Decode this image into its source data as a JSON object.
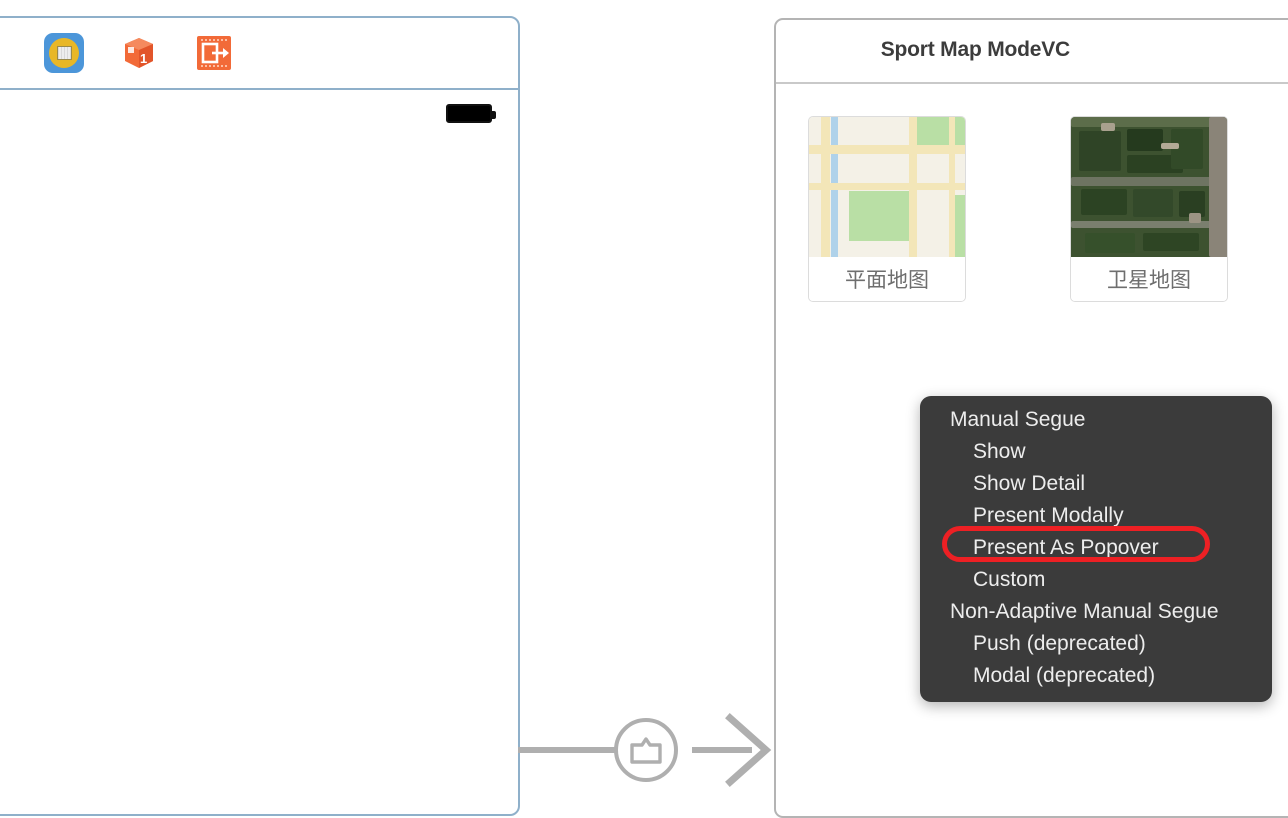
{
  "canvas": {
    "background_color": "#ffffff"
  },
  "left_scene": {
    "border_color": "#8FB0CA",
    "dock": {
      "icons": [
        {
          "name": "view-controller-icon",
          "label": "View Controller",
          "selected": true
        },
        {
          "name": "first-responder-icon",
          "label": "First Responder",
          "badge": "1"
        },
        {
          "name": "exit-icon",
          "label": "Exit"
        }
      ]
    },
    "status_bar": {
      "battery": {
        "name": "battery-icon",
        "level_label": "Battery"
      }
    }
  },
  "segue": {
    "name": "present-modally-segue",
    "badge": "present-modally-glyph",
    "stroke_color": "#AFAFAF"
  },
  "right_scene": {
    "border_color": "#B4B4B4",
    "nav_bar": {
      "title": "Sport Map ModeVC"
    },
    "map_cards": [
      {
        "id": "standard-map",
        "caption": "平面地图",
        "thumb": "standard-map-thumbnail"
      },
      {
        "id": "satellite-map",
        "caption": "卫星地图",
        "thumb": "satellite-map-thumbnail"
      }
    ]
  },
  "segue_menu": {
    "background_color": "#3B3B3B",
    "highlight_color": "#ED2024",
    "highlighted_item": "Present As Popover",
    "items": [
      {
        "label": "Manual Segue",
        "type": "group"
      },
      {
        "label": "Show",
        "type": "child"
      },
      {
        "label": "Show Detail",
        "type": "child"
      },
      {
        "label": "Present Modally",
        "type": "child"
      },
      {
        "label": "Present As Popover",
        "type": "child",
        "highlighted": true
      },
      {
        "label": "Custom",
        "type": "child"
      },
      {
        "label": "Non-Adaptive Manual Segue",
        "type": "group"
      },
      {
        "label": "Push (deprecated)",
        "type": "child"
      },
      {
        "label": "Modal (deprecated)",
        "type": "child"
      }
    ]
  }
}
